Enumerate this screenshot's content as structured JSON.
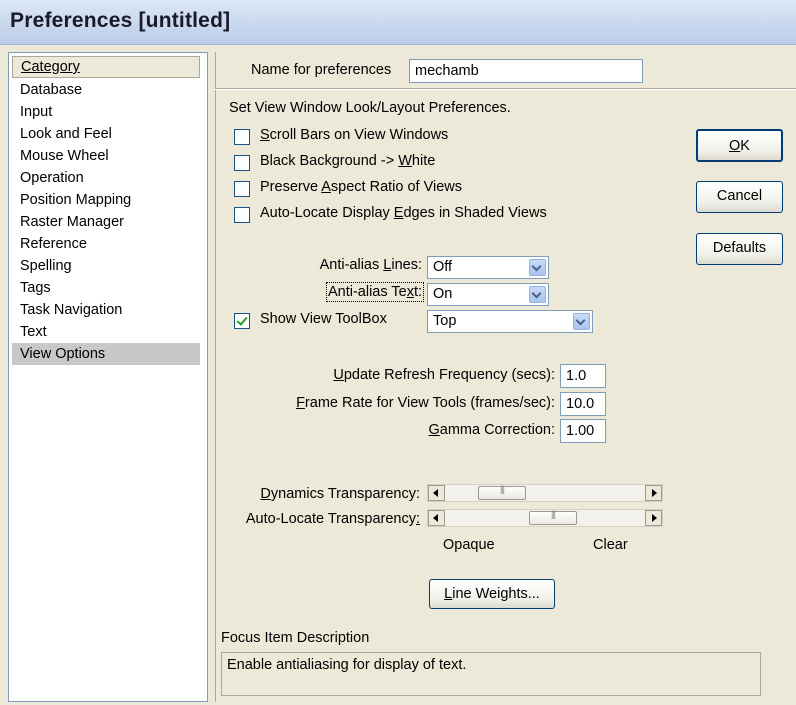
{
  "window": {
    "title": "Preferences [untitled]"
  },
  "category": {
    "header": "Category",
    "items": [
      "Database",
      "Input",
      "Look and Feel",
      "Mouse Wheel",
      "Operation",
      "Position Mapping",
      "Raster Manager",
      "Reference",
      "Spelling",
      "Tags",
      "Task Navigation",
      "Text",
      "View Options"
    ],
    "selected": "View Options"
  },
  "name_for_preferences": {
    "label": "Name for preferences",
    "value": "mechamb"
  },
  "section_label": "Set View Window Look/Layout Preferences.",
  "checkboxes": [
    {
      "pre": "",
      "key": "S",
      "post": "croll Bars on View Windows",
      "checked": false
    },
    {
      "pre": "Black Background -> ",
      "key": "W",
      "post": "hite",
      "checked": false
    },
    {
      "pre": "Preserve ",
      "key": "A",
      "post": "spect Ratio of Views",
      "checked": false
    },
    {
      "pre": "Auto-Locate Display ",
      "key": "E",
      "post": "dges in Shaded Views",
      "checked": false
    }
  ],
  "buttons": {
    "ok": {
      "pre": "",
      "key": "O",
      "post": "K"
    },
    "cancel": "Cancel",
    "defaults": "Defaults",
    "line_weights": {
      "pre": "",
      "key": "L",
      "post": "ine Weights..."
    }
  },
  "antialias_lines": {
    "pre": "Anti-alias ",
    "key": "L",
    "post": "ines:",
    "value": "Off"
  },
  "antialias_text": {
    "pre": "Anti-alias Te",
    "key": "x",
    "post": "t:",
    "value": "On"
  },
  "show_view_toolbox": {
    "label": "Show View ToolBox",
    "checked": true,
    "value": "Top"
  },
  "update_refresh": {
    "pre": "",
    "key": "U",
    "post": "pdate Refresh Frequency (secs):",
    "value": "1.0"
  },
  "frame_rate": {
    "pre": "",
    "key": "F",
    "post": "rame Rate for View Tools (frames/sec):",
    "value": "10.0"
  },
  "gamma": {
    "pre": "",
    "key": "G",
    "post": "amma Correction:",
    "value": "1.00"
  },
  "dynamics_transparency": {
    "pre": "",
    "key": "D",
    "post": "ynamics Transparency:",
    "value_fraction": 0.22
  },
  "autolocate_transparency": {
    "pre": "Auto-Locate Transparency",
    "key": ":",
    "post": "",
    "value_fraction": 0.55
  },
  "scale_labels": {
    "left": "Opaque",
    "right": "Clear"
  },
  "focus": {
    "label": "Focus Item Description",
    "description": "Enable antialiasing for display of text."
  }
}
